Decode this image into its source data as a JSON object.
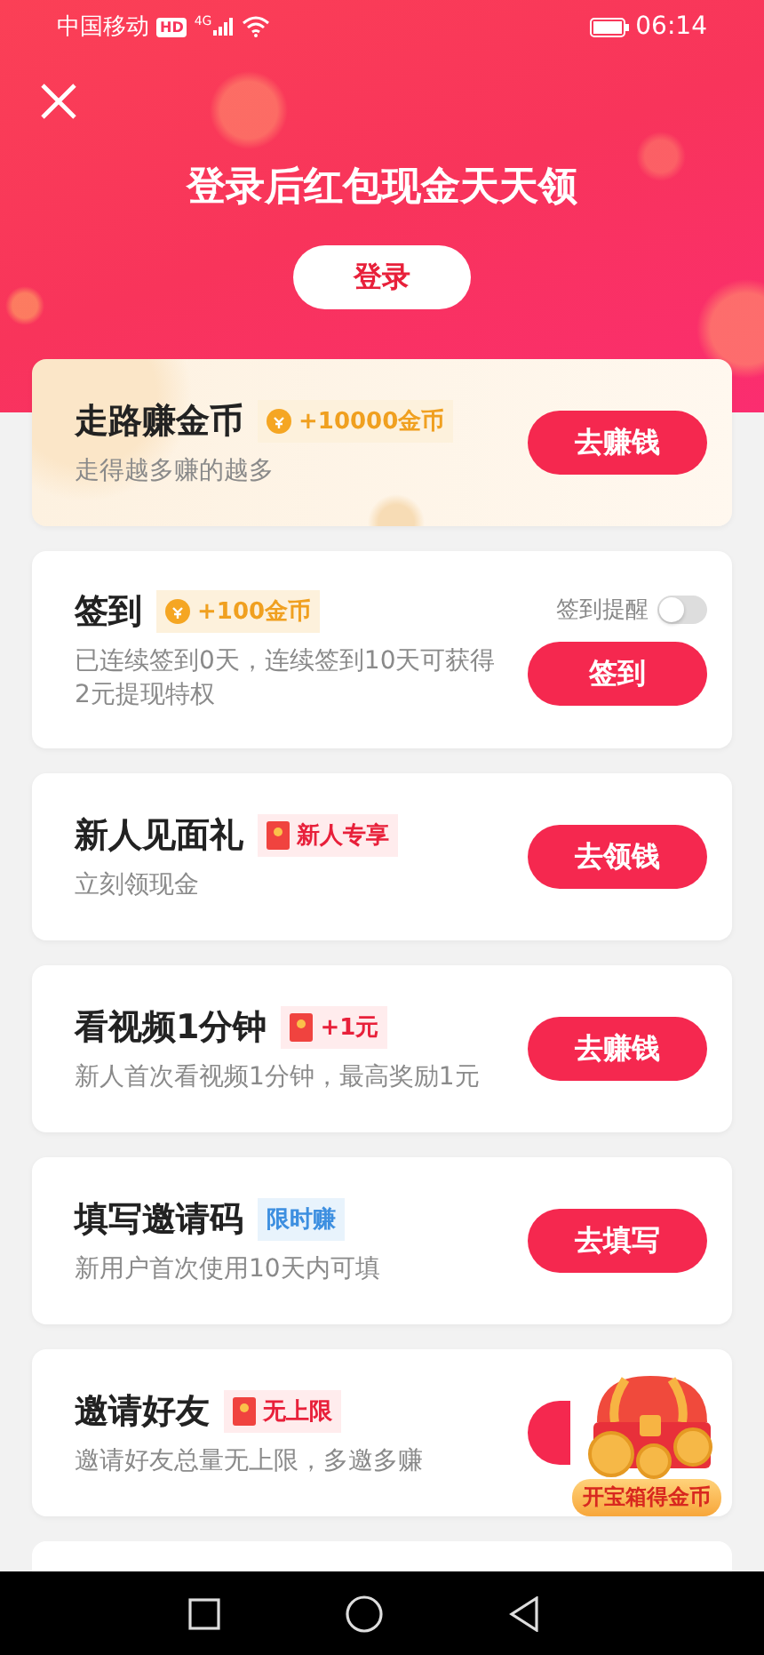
{
  "status_bar": {
    "carrier": "中国移动",
    "hd": "HD",
    "network": "4G",
    "time": "06:14"
  },
  "header": {
    "title": "登录后红包现金天天领",
    "login_button": "登录"
  },
  "tasks": [
    {
      "title": "走路赚金币",
      "badge": {
        "kind": "coin",
        "text": "+10000金币"
      },
      "description": "走得越多赚的越多",
      "button": "去赚钱",
      "highlighted": true
    },
    {
      "title": "签到",
      "badge": {
        "kind": "coin",
        "text": "+100金币"
      },
      "description": "已连续签到0天，连续签到10天可获得2元提现特权",
      "button": "签到",
      "highlighted": false,
      "reminder": {
        "label": "签到提醒",
        "on": false
      }
    },
    {
      "title": "新人见面礼",
      "badge": {
        "kind": "packet",
        "text": "新人专享"
      },
      "description": "立刻领现金",
      "button": "去领钱",
      "highlighted": false
    },
    {
      "title": "看视频1分钟",
      "badge": {
        "kind": "packet",
        "text": "+1元"
      },
      "description": "新人首次看视频1分钟，最高奖励1元",
      "button": "去赚钱",
      "highlighted": false
    },
    {
      "title": "填写邀请码",
      "badge": {
        "kind": "plain",
        "text": "限时赚"
      },
      "description": "新用户首次使用10天内可填",
      "button": "去填写",
      "highlighted": false
    },
    {
      "title": "邀请好友",
      "badge": {
        "kind": "packet",
        "text": "无上限"
      },
      "description": "邀请好友总量无上限，多邀多赚",
      "highlighted": false
    }
  ],
  "chest_badge": {
    "label": "开宝箱得金币"
  }
}
